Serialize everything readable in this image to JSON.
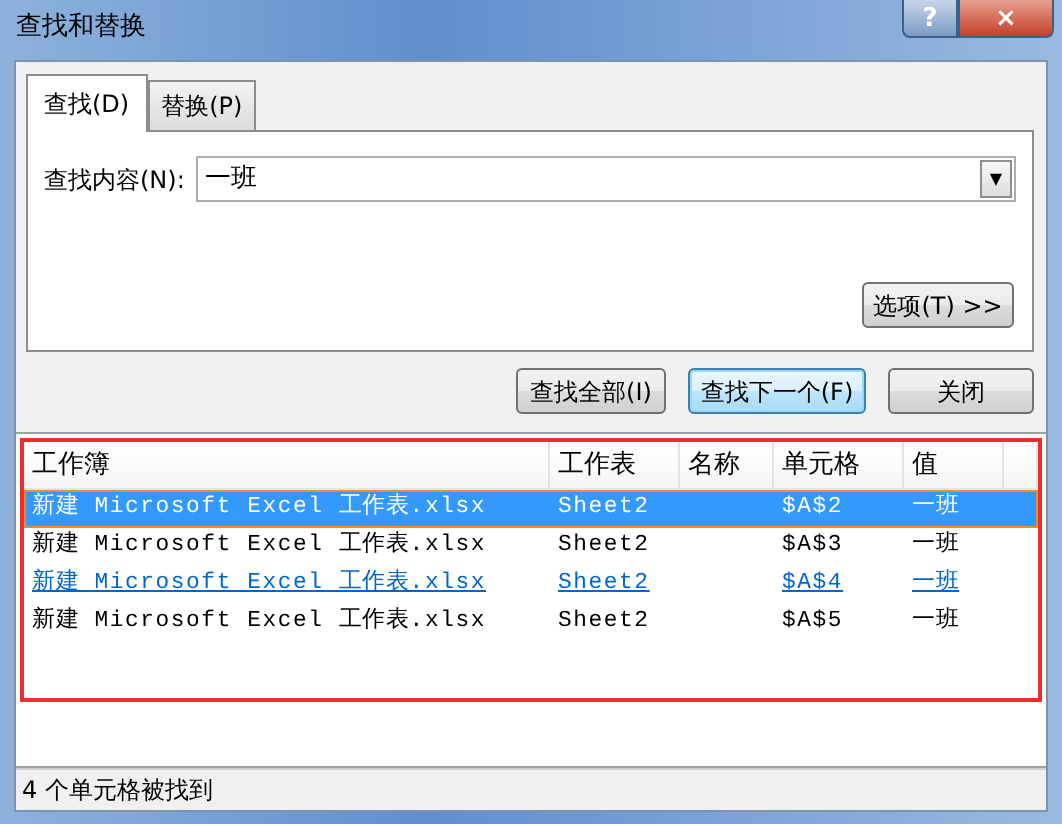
{
  "window": {
    "title": "查找和替换",
    "controls": [
      "?",
      "×"
    ]
  },
  "tabs": [
    {
      "label": "查找(D)",
      "selected": true
    },
    {
      "label": "替换(P)",
      "selected": false
    }
  ],
  "find": {
    "label": "查找内容(N):",
    "value": "一班",
    "dropdown": "▼"
  },
  "options_button": "选项(T) >>",
  "buttons": [
    {
      "label": "查找全部(I)",
      "focused": false
    },
    {
      "label": "查找下一个(F)",
      "focused": true
    },
    {
      "label": "关闭",
      "focused": false
    }
  ],
  "results": {
    "columns": [
      "工作簿",
      "工作表",
      "名称",
      "单元格",
      "值"
    ],
    "rows": [
      {
        "cells": [
          "新建 Microsoft Excel 工作表.xlsx",
          "Sheet2",
          "",
          "$A$2",
          "一班"
        ],
        "selected": true,
        "hovered": false
      },
      {
        "cells": [
          "新建 Microsoft Excel 工作表.xlsx",
          "Sheet2",
          "",
          "$A$3",
          "一班"
        ],
        "selected": false,
        "hovered": false
      },
      {
        "cells": [
          "新建 Microsoft Excel 工作表.xlsx",
          "Sheet2",
          "",
          "$A$4",
          "一班"
        ],
        "selected": false,
        "hovered": true
      },
      {
        "cells": [
          "新建 Microsoft Excel 工作表.xlsx",
          "Sheet2",
          "",
          "$A$5",
          "一班"
        ],
        "selected": false,
        "hovered": false
      }
    ]
  },
  "status_bar": "4 个单元格被找到"
}
